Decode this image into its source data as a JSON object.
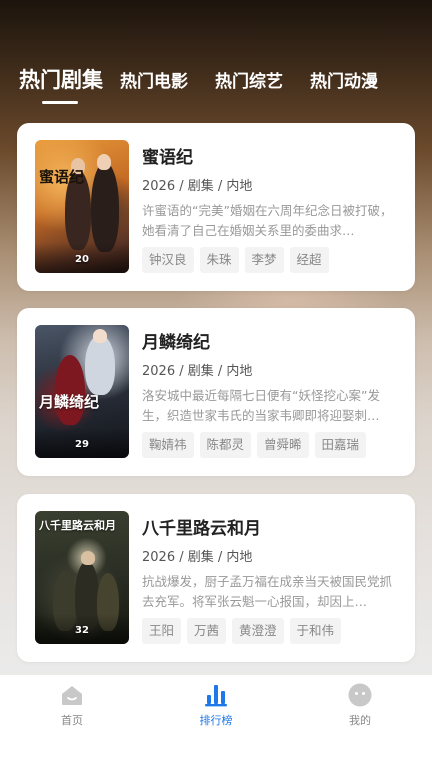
{
  "tabs": [
    {
      "label": "热门剧集",
      "active": true
    },
    {
      "label": "热门电影",
      "active": false
    },
    {
      "label": "热门综艺",
      "active": false
    },
    {
      "label": "热门动漫",
      "active": false
    }
  ],
  "dramas": [
    {
      "title": "蜜语纪",
      "poster_title": "蜜语纪",
      "count": "20",
      "meta": "2026 / 剧集 / 内地",
      "description": "许蜜语的“完美”婚姻在六周年纪念日被打破，她看清了自己在婚姻关系里的委曲求…",
      "actors": [
        "钟汉良",
        "朱珠",
        "李梦",
        "经超"
      ]
    },
    {
      "title": "月鳞绮纪",
      "poster_title": "月鳞绮纪",
      "count": "29",
      "meta": "2026 / 剧集 / 内地",
      "description": "洛安城中最近每隔七日便有“妖怪挖心案”发生，织造世家韦氏的当家韦卿即将迎娶刺…",
      "actors": [
        "鞠婧祎",
        "陈都灵",
        "曾舜晞",
        "田嘉瑞"
      ]
    },
    {
      "title": "八千里路云和月",
      "poster_title": "八千里路云和月",
      "count": "32",
      "meta": "2026 / 剧集 / 内地",
      "description": "抗战爆发，厨子孟万福在成亲当天被国民党抓去充军。将军张云魁一心报国，却因上…",
      "actors": [
        "王阳",
        "万茜",
        "黄澄澄",
        "于和伟"
      ]
    }
  ],
  "nav": [
    {
      "label": "首页",
      "icon": "home-icon",
      "active": false
    },
    {
      "label": "排行榜",
      "icon": "ranking-icon",
      "active": true
    },
    {
      "label": "我的",
      "icon": "profile-icon",
      "active": false
    }
  ],
  "colors": {
    "accent": "#1e78e8",
    "nav_inactive": "#c8c8c8"
  }
}
